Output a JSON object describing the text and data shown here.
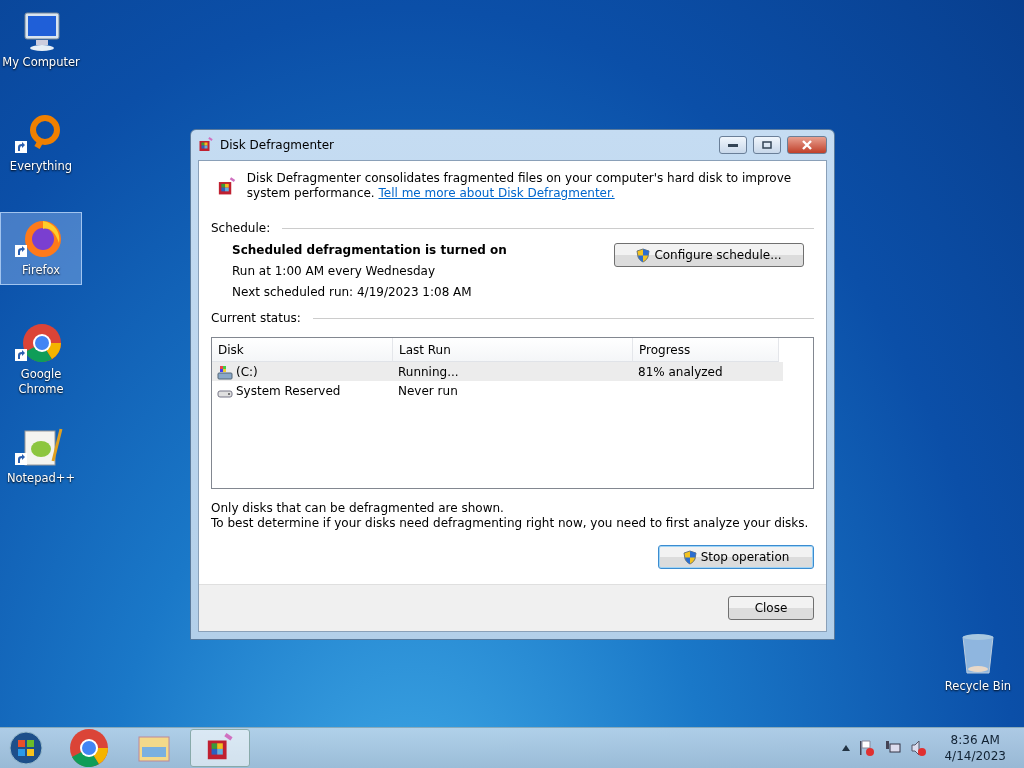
{
  "desktop_icons": [
    {
      "label": "My Computer",
      "kind": "computer",
      "shortcut": false,
      "selected": false
    },
    {
      "label": "Everything",
      "kind": "ring",
      "shortcut": true,
      "selected": false
    },
    {
      "label": "Firefox",
      "kind": "firefox",
      "shortcut": true,
      "selected": true
    },
    {
      "label": "Google Chrome",
      "kind": "chrome",
      "shortcut": true,
      "selected": false
    },
    {
      "label": "Notepad++",
      "kind": "notepad",
      "shortcut": true,
      "selected": false
    },
    {
      "label": "Recycle Bin",
      "kind": "bin",
      "shortcut": false,
      "selected": false
    }
  ],
  "window": {
    "title": "Disk Defragmenter",
    "intro": "Disk Defragmenter consolidates fragmented files on your computer's hard disk to improve system performance.",
    "link": "Tell me more about Disk Defragmenter.",
    "schedule_heading": "Schedule:",
    "schedule_status": "Scheduled defragmentation is turned on",
    "schedule_lines": [
      "Run at 1:00 AM every Wednesday",
      "Next scheduled run: 4/19/2023 1:08 AM"
    ],
    "configure_button": "Configure schedule...",
    "status_heading": "Current status:",
    "table": {
      "columns": [
        "Disk",
        "Last Run",
        "Progress"
      ],
      "rows": [
        {
          "kind": "system",
          "disk": "(C:)",
          "last_run": "Running...",
          "progress": "81% analyzed",
          "selected": true
        },
        {
          "kind": "drive",
          "disk": "System Reserved",
          "last_run": "Never run",
          "progress": "",
          "selected": false
        }
      ]
    },
    "notes": [
      "Only disks that can be defragmented are shown.",
      "To best determine if your disks need defragmenting right now, you need to first analyze your disks."
    ],
    "stop_button": "Stop operation",
    "close_button": "Close"
  },
  "taskbar": {
    "items": [
      {
        "kind": "chrome",
        "selected": false
      },
      {
        "kind": "explorer",
        "selected": false
      },
      {
        "kind": "defrag",
        "selected": true
      }
    ],
    "time": "8:36 AM",
    "date": "4/14/2023"
  }
}
